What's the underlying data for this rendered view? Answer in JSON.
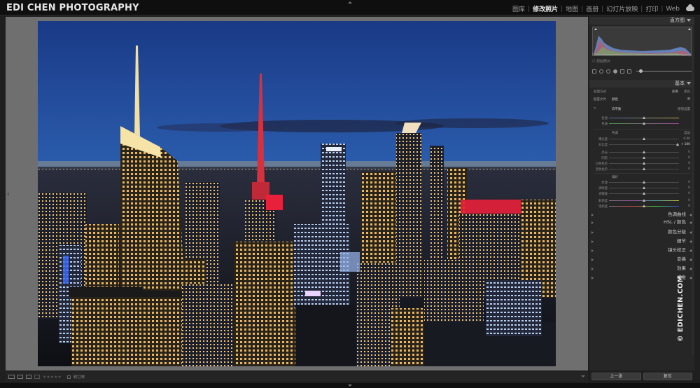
{
  "app": {
    "brand": "EDI CHEN PHOTOGRAPHY",
    "modules": [
      "图库",
      "修改照片",
      "地图",
      "画册",
      "幻灯片放映",
      "打印",
      "Web"
    ],
    "active_module": "修改照片"
  },
  "right_panel": {
    "histogram_label": "直方图",
    "histogram_values": [
      "ISO 400",
      "26.0 mm",
      "f / 8.0",
      "1/2 秒"
    ],
    "original_photo_label": "原始照片",
    "basic_label": "基本",
    "treatment_label": "处理方式",
    "treatment_options": [
      "彩色",
      "黑白"
    ],
    "profile_label": "配置文件",
    "profile_value": "颜色",
    "wb_label": "白平衡",
    "wb_value": "原照设置",
    "temp_label": "色温",
    "tint_label": "色调",
    "tone_label": "色调",
    "auto_label": "自动",
    "tone_sliders": [
      {
        "label": "曝光度",
        "value": "0.00"
      },
      {
        "label": "对比度",
        "value": "+ 100"
      },
      {
        "label": "高光",
        "value": "0"
      },
      {
        "label": "阴影",
        "value": "0"
      },
      {
        "label": "白色色阶",
        "value": "0"
      },
      {
        "label": "黑色色阶",
        "value": "0"
      }
    ],
    "presence_label": "偏好",
    "presence_sliders": [
      {
        "label": "纹理",
        "value": "0"
      },
      {
        "label": "清晰度",
        "value": "0"
      },
      {
        "label": "去朦胧",
        "value": "0"
      },
      {
        "label": "鲜艳度",
        "value": "0"
      },
      {
        "label": "饱和度",
        "value": "0"
      }
    ],
    "sections": [
      "色调曲线",
      "HSL / 颜色",
      "颜色分级",
      "细节",
      "镜头校正",
      "变换",
      "效果",
      "校准"
    ],
    "buttons": [
      "上一张",
      "复位"
    ]
  },
  "bottom_toolbar": {
    "soft_proof_label": "软打样",
    "rating_stars": "★★★★★"
  },
  "watermark": "© EDICHEN.COM",
  "colors": {
    "accent_red": "#e8203a",
    "sky_top": "#1d3f8c",
    "sky_horizon": "#e98a5a"
  }
}
